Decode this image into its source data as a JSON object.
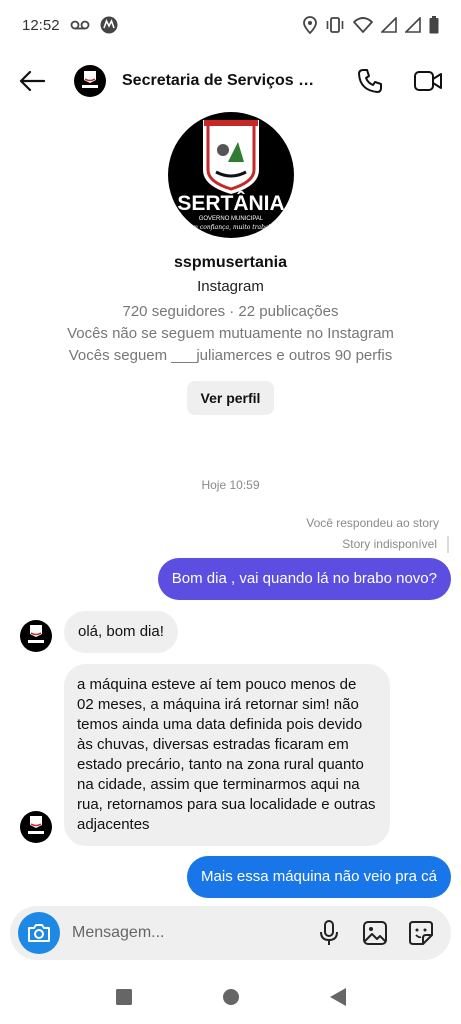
{
  "status_bar": {
    "time": "12:52"
  },
  "header": {
    "title": "Secretaria de Serviços Pú...",
    "avatar_text": "SERTÂNIA"
  },
  "profile": {
    "logo_text": "SERTÂNIA",
    "logo_subtext": "GOVERNO MUNICIPAL",
    "logo_tagline": "Com confiança, muito trabalho",
    "username": "sspmusertania",
    "platform": "Instagram",
    "stats": "720 seguidores · 22 publicações",
    "mutual": "Vocês não se seguem mutuamente no Instagram",
    "follows": "Vocês seguem ___juliamerces e outros 90 perfis",
    "view_profile_label": "Ver perfil"
  },
  "chat": {
    "timestamp": "Hoje 10:59",
    "reply_note": "Você respondeu ao story",
    "story_note": "Story indisponível",
    "messages": [
      {
        "from": "me",
        "text": "Bom dia , vai quando lá no brabo novo?"
      },
      {
        "from": "them",
        "text": "olá, bom dia!"
      },
      {
        "from": "them",
        "text": "a máquina esteve aí tem pouco menos de 02 meses, a máquina irá retornar sim! não temos ainda uma data definida pois devido às chuvas, diversas estradas ficaram em estado precário, tanto na zona rural quanto na cidade, assim que terminarmos aqui na rua, retornamos para sua localidade e outras adjacentes"
      },
      {
        "from": "me",
        "text": "Mais essa máquina não veio pra cá"
      }
    ]
  },
  "composer": {
    "placeholder": "Mensagem..."
  },
  "colors": {
    "bubble_out_1": "#5b4ee0",
    "bubble_out_2": "#1976e8",
    "bubble_in": "#efefef",
    "camera": "#1e88e5"
  }
}
